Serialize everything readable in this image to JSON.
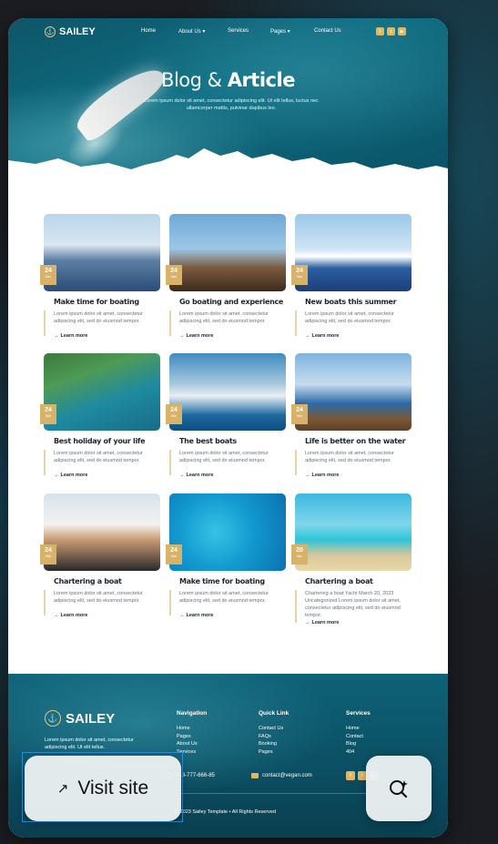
{
  "site": {
    "logo_text": "SAILEY",
    "nav": [
      {
        "label": "Home"
      },
      {
        "label": "About Us ▾"
      },
      {
        "label": "Services"
      },
      {
        "label": "Pages ▾"
      },
      {
        "label": "Contact Us"
      }
    ],
    "hero": {
      "title_a": "Blog & ",
      "title_b": "Article",
      "subtitle": "Lorem ipsum dolor sit amet, consectetur adipiscing elit. Ut elit tellus, luctus nec ullamcorper mattis, pulvinar dapibus leo."
    },
    "posts": [
      {
        "day": "24",
        "title": "Make time for boating",
        "text": "Lorem ipsum dolor sit amet, consectetur adipiscing elit, sed do eiusmod tempor.",
        "more": "Learn more"
      },
      {
        "day": "24",
        "title": "Go boating and experience",
        "text": "Lorem ipsum dolor sit amet, consectetur adipiscing elit, sed do eiusmod tempor.",
        "more": "Learn more"
      },
      {
        "day": "24",
        "title": "New boats this summer",
        "text": "Lorem ipsum dolor sit amet, consectetur adipiscing elit, sed do eiusmod tempor.",
        "more": "Learn more"
      },
      {
        "day": "24",
        "title": "Best holiday of your life",
        "text": "Lorem ipsum dolor sit amet, consectetur adipiscing elit, sed do eiusmod tempor.",
        "more": "Learn more"
      },
      {
        "day": "24",
        "title": "The best boats",
        "text": "Lorem ipsum dolor sit amet, consectetur adipiscing elit, sed do eiusmod tempor.",
        "more": "Learn more"
      },
      {
        "day": "24",
        "title": "Life is better on the water",
        "text": "Lorem ipsum dolor sit amet, consectetur adipiscing elit, sed do eiusmod tempor.",
        "more": "Learn more"
      },
      {
        "day": "24",
        "title": "Chartering a boat",
        "text": "Lorem ipsum dolor sit amet, consectetur adipiscing elit, sed do eiusmod tempor.",
        "more": "Learn more"
      },
      {
        "day": "24",
        "title": "Make time for boating",
        "text": "Lorem ipsum dolor sit amet, consectetur adipiscing elit, sed do eiusmod tempor.",
        "more": "Learn more"
      },
      {
        "day": "20",
        "title": "Chartering a boat",
        "text": "Chartering a boat Yacht March 20, 2023 Uncategorized Lorem ipsum dolor sit amet, consectetur adipiscing elit, sed do eiusmod tempor.",
        "more": "Learn more"
      }
    ],
    "footer": {
      "logo_text": "SAILEY",
      "about": "Lorem ipsum dolor sit amet, consectetur adipiscing elit. Ut elit tellus.",
      "columns": [
        {
          "heading": "Navigation",
          "items": [
            "Home",
            "Pages",
            "About Us",
            "Services"
          ]
        },
        {
          "heading": "Quick Link",
          "items": [
            "Contact Us",
            "FAQs",
            "Booking",
            "Pages"
          ]
        },
        {
          "heading": "Services",
          "items": [
            "Home",
            "Contact",
            "Blog",
            "404"
          ]
        }
      ],
      "phone": "+18-777-666-85",
      "email": "contact@vegan.com",
      "copyright": "© 2023 Sailey Template • All Rights Reserved"
    }
  },
  "overlay": {
    "visit_label": "Visit site"
  },
  "colors": {
    "accent": "#d9b26a",
    "ocean": "#0d6c80",
    "link_outline": "#2b8fd6"
  }
}
